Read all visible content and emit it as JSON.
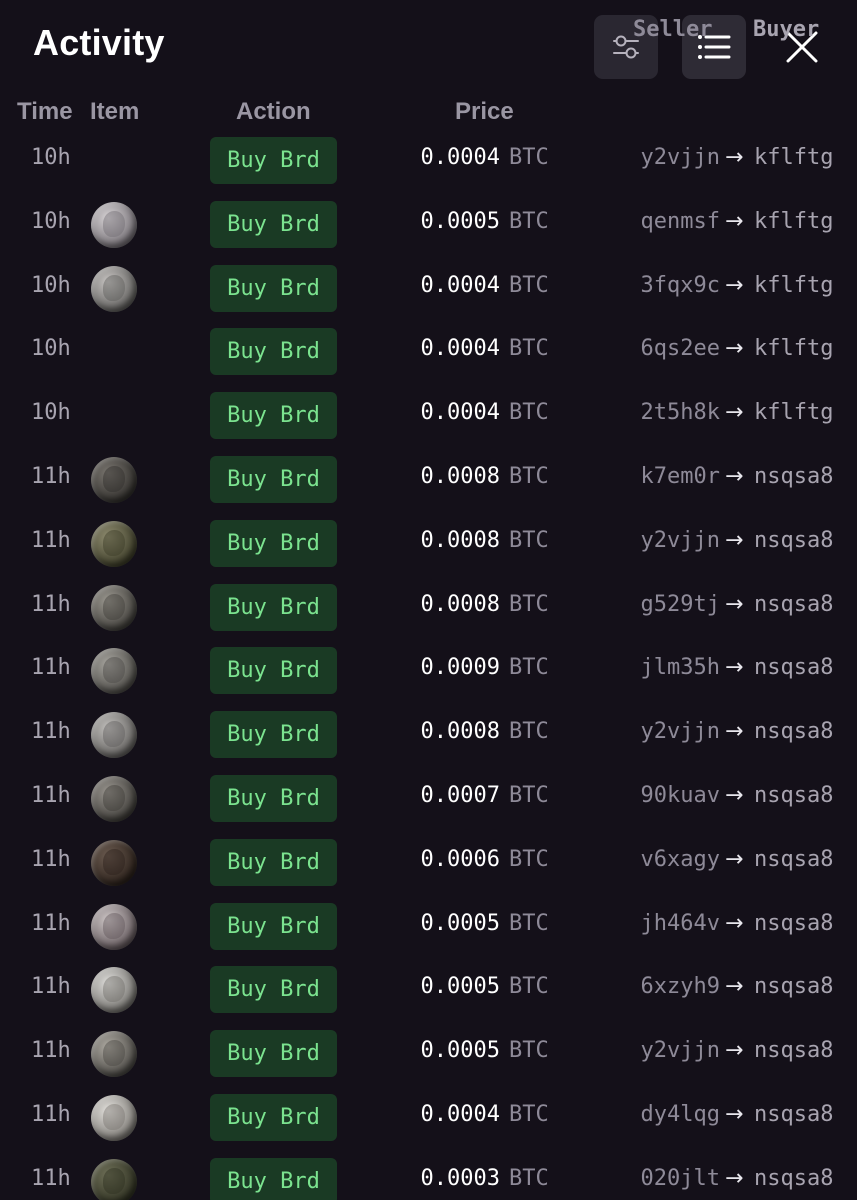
{
  "header": {
    "title": "Activity",
    "filter_icon": "sliders-icon",
    "list_icon": "list-icon",
    "close_icon": "close-icon"
  },
  "columns": {
    "time": "Time",
    "item": "Item",
    "action": "Action",
    "price": "Price",
    "seller": "Seller",
    "buyer": "Buyer"
  },
  "colors": {
    "background": "#141019",
    "action_bg": "#1a3a24",
    "action_text": "#7be38f",
    "muted_text": "#8e8a98"
  },
  "rows": [
    {
      "time": "10h",
      "item_icon": "",
      "action": "Buy Brd",
      "price": "0.0004",
      "unit": "BTC",
      "seller": "y2vjjn",
      "arrow": "→",
      "buyer": "kflftg"
    },
    {
      "time": "10h",
      "item_icon": "coin-icon",
      "action": "Buy Brd",
      "price": "0.0005",
      "unit": "BTC",
      "seller": "qenmsf",
      "arrow": "→",
      "buyer": "kflftg"
    },
    {
      "time": "10h",
      "item_icon": "coin-icon",
      "action": "Buy Brd",
      "price": "0.0004",
      "unit": "BTC",
      "seller": "3fqx9c",
      "arrow": "→",
      "buyer": "kflftg"
    },
    {
      "time": "10h",
      "item_icon": "",
      "action": "Buy Brd",
      "price": "0.0004",
      "unit": "BTC",
      "seller": "6qs2ee",
      "arrow": "→",
      "buyer": "kflftg"
    },
    {
      "time": "10h",
      "item_icon": "",
      "action": "Buy Brd",
      "price": "0.0004",
      "unit": "BTC",
      "seller": "2t5h8k",
      "arrow": "→",
      "buyer": "kflftg"
    },
    {
      "time": "11h",
      "item_icon": "coin-icon",
      "action": "Buy Brd",
      "price": "0.0008",
      "unit": "BTC",
      "seller": "k7em0r",
      "arrow": "→",
      "buyer": "nsqsa8"
    },
    {
      "time": "11h",
      "item_icon": "coin-icon",
      "action": "Buy Brd",
      "price": "0.0008",
      "unit": "BTC",
      "seller": "y2vjjn",
      "arrow": "→",
      "buyer": "nsqsa8"
    },
    {
      "time": "11h",
      "item_icon": "coin-icon",
      "action": "Buy Brd",
      "price": "0.0008",
      "unit": "BTC",
      "seller": "g529tj",
      "arrow": "→",
      "buyer": "nsqsa8"
    },
    {
      "time": "11h",
      "item_icon": "coin-icon",
      "action": "Buy Brd",
      "price": "0.0009",
      "unit": "BTC",
      "seller": "jlm35h",
      "arrow": "→",
      "buyer": "nsqsa8"
    },
    {
      "time": "11h",
      "item_icon": "coin-icon",
      "action": "Buy Brd",
      "price": "0.0008",
      "unit": "BTC",
      "seller": "y2vjjn",
      "arrow": "→",
      "buyer": "nsqsa8"
    },
    {
      "time": "11h",
      "item_icon": "coin-icon",
      "action": "Buy Brd",
      "price": "0.0007",
      "unit": "BTC",
      "seller": "90kuav",
      "arrow": "→",
      "buyer": "nsqsa8"
    },
    {
      "time": "11h",
      "item_icon": "coin-icon",
      "action": "Buy Brd",
      "price": "0.0006",
      "unit": "BTC",
      "seller": "v6xagy",
      "arrow": "→",
      "buyer": "nsqsa8"
    },
    {
      "time": "11h",
      "item_icon": "coin-icon",
      "action": "Buy Brd",
      "price": "0.0005",
      "unit": "BTC",
      "seller": "jh464v",
      "arrow": "→",
      "buyer": "nsqsa8"
    },
    {
      "time": "11h",
      "item_icon": "coin-icon",
      "action": "Buy Brd",
      "price": "0.0005",
      "unit": "BTC",
      "seller": "6xzyh9",
      "arrow": "→",
      "buyer": "nsqsa8"
    },
    {
      "time": "11h",
      "item_icon": "coin-icon",
      "action": "Buy Brd",
      "price": "0.0005",
      "unit": "BTC",
      "seller": "y2vjjn",
      "arrow": "→",
      "buyer": "nsqsa8"
    },
    {
      "time": "11h",
      "item_icon": "coin-icon",
      "action": "Buy Brd",
      "price": "0.0004",
      "unit": "BTC",
      "seller": "dy4lqg",
      "arrow": "→",
      "buyer": "nsqsa8"
    },
    {
      "time": "11h",
      "item_icon": "coin-icon",
      "action": "Buy Brd",
      "price": "0.0003",
      "unit": "BTC",
      "seller": "020jlt",
      "arrow": "→",
      "buyer": "nsqsa8"
    }
  ]
}
